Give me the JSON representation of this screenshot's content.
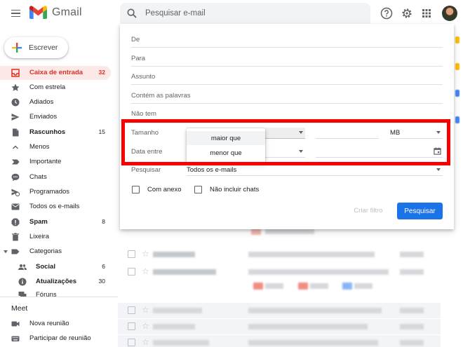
{
  "header": {
    "app_title": "Gmail",
    "search_placeholder": "Pesquisar e-mail",
    "icons": [
      "menu-icon",
      "help-icon",
      "settings-icon",
      "apps-icon"
    ]
  },
  "compose": {
    "label": "Escrever"
  },
  "sidebar": {
    "items": [
      {
        "label": "Caixa de entrada",
        "count": "32",
        "icon": "inbox-icon",
        "active": true
      },
      {
        "label": "Com estrela",
        "count": "",
        "icon": "star-icon"
      },
      {
        "label": "Adiados",
        "count": "",
        "icon": "clock-icon"
      },
      {
        "label": "Enviados",
        "count": "",
        "icon": "send-icon"
      },
      {
        "label": "Rascunhos",
        "count": "15",
        "icon": "draft-icon",
        "bold": true
      },
      {
        "label": "Menos",
        "count": "",
        "icon": "chevron-up-icon"
      },
      {
        "label": "Importante",
        "count": "",
        "icon": "important-icon"
      },
      {
        "label": "Chats",
        "count": "",
        "icon": "chat-icon"
      },
      {
        "label": "Programados",
        "count": "",
        "icon": "scheduled-icon"
      },
      {
        "label": "Todos os e-mails",
        "count": "",
        "icon": "all-mail-icon"
      },
      {
        "label": "Spam",
        "count": "8",
        "icon": "spam-icon",
        "bold": true
      },
      {
        "label": "Lixeira",
        "count": "",
        "icon": "trash-icon"
      },
      {
        "label": "Categorias",
        "count": "",
        "icon": "label-icon"
      },
      {
        "label": "Social",
        "count": "6",
        "icon": "people-icon",
        "bold": true,
        "sub": true
      },
      {
        "label": "Atualizações",
        "count": "30",
        "icon": "info-icon",
        "bold": true,
        "sub": true
      },
      {
        "label": "Fóruns",
        "count": "",
        "icon": "forum-icon",
        "sub": true
      }
    ],
    "meet": {
      "title": "Meet",
      "items": [
        {
          "label": "Nova reunião",
          "icon": "video-icon"
        },
        {
          "label": "Participar de reunião",
          "icon": "keyboard-icon"
        }
      ]
    }
  },
  "advanced_search": {
    "fields": {
      "from": "De",
      "to": "Para",
      "subject": "Assunto",
      "has_words": "Contém as palavras",
      "not_have": "Não tem",
      "size": "Tamanho",
      "date_within": "Data entre",
      "search_in": "Pesquisar"
    },
    "size_unit": "MB",
    "search_in_value": "Todos os e-mails",
    "size_options": [
      "maior que",
      "menor que"
    ],
    "has_attachment": "Com anexo",
    "exclude_chats": "Não incluir chats",
    "create_filter": "Criar filtro",
    "search_button": "Pesquisar"
  },
  "colors": {
    "accent_red": "#d93025",
    "primary_blue": "#1a73e8",
    "highlight_red": "#f80000"
  }
}
